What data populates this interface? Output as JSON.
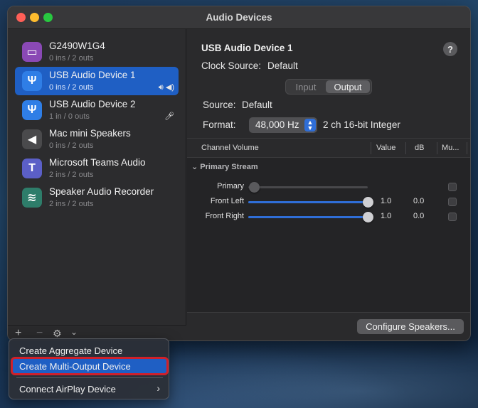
{
  "window": {
    "title": "Audio Devices"
  },
  "devices": [
    {
      "name": "G2490W1G4",
      "sub": "0 ins / 2 outs",
      "icon": "monitor-icon",
      "color": "#8a49b5",
      "badge": ""
    },
    {
      "name": "USB Audio Device 1",
      "sub": "0 ins / 2 outs",
      "icon": "usb-icon",
      "color": "#2f7ee6",
      "badge": "🔊︎ ◀)",
      "selected": true
    },
    {
      "name": "USB Audio Device 2",
      "sub": "1 in / 0 outs",
      "icon": "usb-icon",
      "color": "#2f7ee6",
      "badge": "🎤︎"
    },
    {
      "name": "Mac mini Speakers",
      "sub": "0 ins / 2 outs",
      "icon": "speaker-icon",
      "color": "#4a4a4c",
      "badge": ""
    },
    {
      "name": "Microsoft Teams Audio",
      "sub": "2 ins / 2 outs",
      "icon": "teams-icon",
      "color": "#5b5fc7",
      "badge": ""
    },
    {
      "name": "Speaker Audio Recorder",
      "sub": "2 ins / 2 outs",
      "icon": "recorder-icon",
      "color": "#2e7d6a",
      "badge": ""
    }
  ],
  "sidebar_bottom": {
    "add": "+",
    "remove": "−",
    "gear": "⚙",
    "chevron": "⌄"
  },
  "detail": {
    "title": "USB Audio Device 1",
    "clock_label": "Clock Source:",
    "clock_value": "Default",
    "help": "?",
    "tabs": [
      {
        "label": "Input",
        "selected": false
      },
      {
        "label": "Output",
        "selected": true
      }
    ],
    "source_label": "Source:",
    "source_value": "Default",
    "format_label": "Format:",
    "format_value": "48,000 Hz",
    "format_desc": "2 ch 16-bit Integer",
    "configure_label": "Configure Speakers..."
  },
  "table": {
    "headers": {
      "channel": "Channel Volume",
      "value": "Value",
      "db": "dB",
      "mute": "Mu..."
    },
    "group": "Primary Stream",
    "rows": [
      {
        "name": "Primary",
        "value": "",
        "db": "",
        "level": 0.05,
        "enabled": false
      },
      {
        "name": "Front Left",
        "value": "1.0",
        "db": "0.0",
        "level": 1.0,
        "enabled": true
      },
      {
        "name": "Front Right",
        "value": "1.0",
        "db": "0.0",
        "level": 1.0,
        "enabled": true
      }
    ]
  },
  "menu": {
    "items": [
      {
        "label": "Create Aggregate Device"
      },
      {
        "label": "Create Multi-Output Device",
        "highlighted": true
      },
      {
        "label": "Connect AirPlay Device",
        "submenu": "›"
      }
    ]
  }
}
